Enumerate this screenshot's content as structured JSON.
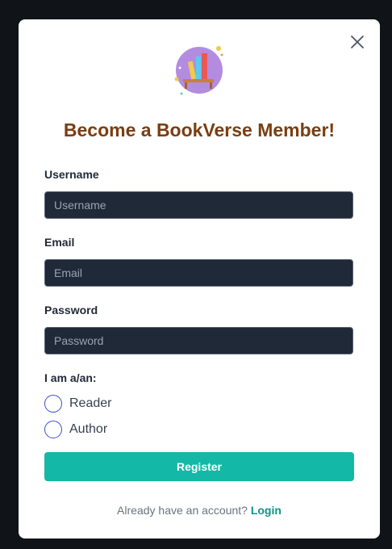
{
  "modal": {
    "title": "Become a BookVerse Member!",
    "close_icon": "close-icon",
    "logo_icon": "bookshelf-icon"
  },
  "form": {
    "username": {
      "label": "Username",
      "placeholder": "Username"
    },
    "email": {
      "label": "Email",
      "placeholder": "Email"
    },
    "password": {
      "label": "Password",
      "placeholder": "Password"
    },
    "role": {
      "label": "I am a/an:",
      "options": [
        "Reader",
        "Author"
      ]
    },
    "submit_label": "Register"
  },
  "footer": {
    "prompt": "Already have an account?",
    "link_label": "Login"
  },
  "colors": {
    "backdrop": "#101418",
    "title": "#7a3e12",
    "input_bg": "#1f2937",
    "button": "#14b8a6",
    "link": "#0d9488"
  }
}
